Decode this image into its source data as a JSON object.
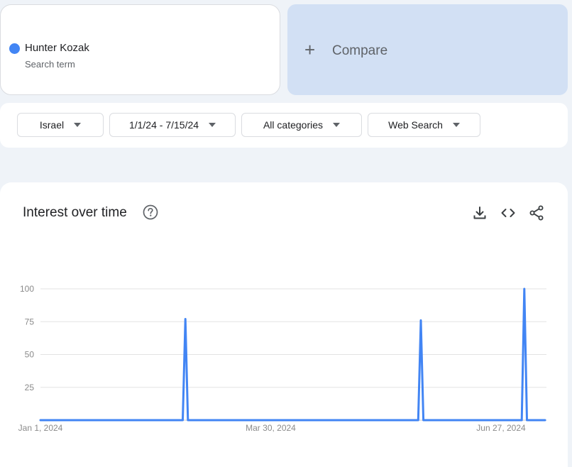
{
  "search_term": {
    "name": "Hunter Kozak",
    "subtitle": "Search term",
    "color": "#4285f4"
  },
  "compare": {
    "plus": "+",
    "label": "Compare"
  },
  "filters": {
    "region": "Israel",
    "date_range": "1/1/24 - 7/15/24",
    "category": "All categories",
    "search_type": "Web Search"
  },
  "panel": {
    "title": "Interest over time",
    "icons": [
      "help-icon",
      "download-icon",
      "embed-code-icon",
      "share-icon"
    ]
  },
  "chart_data": {
    "type": "line",
    "x_start": "2024-01-01",
    "x_end": "2024-07-14",
    "x_ticks": [
      {
        "date": "2024-01-01",
        "label": "Jan 1, 2024"
      },
      {
        "date": "2024-03-30",
        "label": "Mar 30, 2024"
      },
      {
        "date": "2024-06-27",
        "label": "Jun 27, 2024"
      }
    ],
    "y_ticks": [
      25,
      50,
      75,
      100
    ],
    "ylim": [
      0,
      100
    ],
    "grid": true,
    "series": [
      {
        "color": "#4285f4",
        "points": [
          {
            "x": "2024-01-01",
            "y": 0
          },
          {
            "x": "2024-02-25",
            "y": 0
          },
          {
            "x": "2024-02-26",
            "y": 77
          },
          {
            "x": "2024-02-27",
            "y": 0
          },
          {
            "x": "2024-05-26",
            "y": 0
          },
          {
            "x": "2024-05-27",
            "y": 76
          },
          {
            "x": "2024-05-28",
            "y": 0
          },
          {
            "x": "2024-07-05",
            "y": 0
          },
          {
            "x": "2024-07-06",
            "y": 100
          },
          {
            "x": "2024-07-07",
            "y": 0
          },
          {
            "x": "2024-07-14",
            "y": 0
          }
        ]
      }
    ]
  }
}
